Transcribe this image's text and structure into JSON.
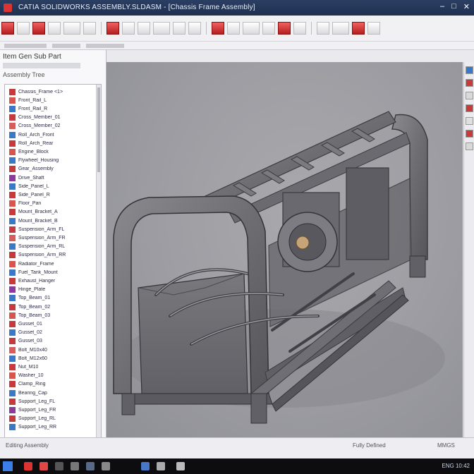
{
  "window": {
    "title": "CATIA  SOLIDWORKS  ASSEMBLY.SLDASM  -  [Chassis Frame Assembly]"
  },
  "left_panel": {
    "header": "Item  Gen  Sub  Part",
    "label3": "Assembly Tree"
  },
  "tree": {
    "items": [
      {
        "label": "Chassis_Frame <1>",
        "icon_color": "#c7393a"
      },
      {
        "label": "Front_Rail_L",
        "icon_color": "#d9544d"
      },
      {
        "label": "Front_Rail_R",
        "icon_color": "#3a78c9"
      },
      {
        "label": "Cross_Member_01",
        "icon_color": "#c7393a"
      },
      {
        "label": "Cross_Member_02",
        "icon_color": "#d95c5c"
      },
      {
        "label": "Roll_Arch_Front",
        "icon_color": "#3a78c9"
      },
      {
        "label": "Roll_Arch_Rear",
        "icon_color": "#c7393a"
      },
      {
        "label": "Engine_Block",
        "icon_color": "#d9544d"
      },
      {
        "label": "Flywheel_Housing",
        "icon_color": "#3a78c9"
      },
      {
        "label": "Gear_Assembly",
        "icon_color": "#c7393a"
      },
      {
        "label": "Drive_Shaft",
        "icon_color": "#8b3a9e"
      },
      {
        "label": "Side_Panel_L",
        "icon_color": "#3a78c9"
      },
      {
        "label": "Side_Panel_R",
        "icon_color": "#c7393a"
      },
      {
        "label": "Floor_Pan",
        "icon_color": "#d9544d"
      },
      {
        "label": "Mount_Bracket_A",
        "icon_color": "#c7393a"
      },
      {
        "label": "Mount_Bracket_B",
        "icon_color": "#3a78c9"
      },
      {
        "label": "Suspension_Arm_FL",
        "icon_color": "#c7393a"
      },
      {
        "label": "Suspension_Arm_FR",
        "icon_color": "#d95c5c"
      },
      {
        "label": "Suspension_Arm_RL",
        "icon_color": "#3a78c9"
      },
      {
        "label": "Suspension_Arm_RR",
        "icon_color": "#c7393a"
      },
      {
        "label": "Radiator_Frame",
        "icon_color": "#d9544d"
      },
      {
        "label": "Fuel_Tank_Mount",
        "icon_color": "#3a78c9"
      },
      {
        "label": "Exhaust_Hanger",
        "icon_color": "#c7393a"
      },
      {
        "label": "Hinge_Plate",
        "icon_color": "#8b3a9e"
      },
      {
        "label": "Top_Beam_01",
        "icon_color": "#3a78c9"
      },
      {
        "label": "Top_Beam_02",
        "icon_color": "#c7393a"
      },
      {
        "label": "Top_Beam_03",
        "icon_color": "#d9544d"
      },
      {
        "label": "Gusset_01",
        "icon_color": "#c7393a"
      },
      {
        "label": "Gusset_02",
        "icon_color": "#3a78c9"
      },
      {
        "label": "Gusset_03",
        "icon_color": "#c7393a"
      },
      {
        "label": "Bolt_M10x40",
        "icon_color": "#d95c5c"
      },
      {
        "label": "Bolt_M12x60",
        "icon_color": "#3a78c9"
      },
      {
        "label": "Nut_M10",
        "icon_color": "#c7393a"
      },
      {
        "label": "Washer_10",
        "icon_color": "#d9544d"
      },
      {
        "label": "Clamp_Ring",
        "icon_color": "#c7393a"
      },
      {
        "label": "Bearing_Cap",
        "icon_color": "#3a78c9"
      },
      {
        "label": "Support_Leg_FL",
        "icon_color": "#c7393a"
      },
      {
        "label": "Support_Leg_FR",
        "icon_color": "#8b3a9e"
      },
      {
        "label": "Support_Leg_RL",
        "icon_color": "#c7393a"
      },
      {
        "label": "Support_Leg_RR",
        "icon_color": "#3a78c9"
      }
    ]
  },
  "toolbar": {
    "buttons": [
      {
        "name": "new-file-button",
        "color": "#c7393a"
      },
      {
        "name": "open-button",
        "color": "#cccccc"
      },
      {
        "name": "save-button",
        "color": "#c7393a"
      },
      {
        "name": "print-button",
        "color": "#cccccc"
      },
      {
        "name": "undo-button",
        "color": "#cccccc"
      },
      {
        "name": "redo-button",
        "color": "#cccccc"
      },
      {
        "name": "rebuild-button",
        "color": "#c7393a"
      },
      {
        "name": "options-button",
        "color": "#cccccc"
      },
      {
        "name": "zoom-fit-button",
        "color": "#cccccc"
      },
      {
        "name": "zoom-area-button",
        "color": "#cccccc"
      },
      {
        "name": "rotate-button",
        "color": "#cccccc"
      },
      {
        "name": "pan-button",
        "color": "#cccccc"
      },
      {
        "name": "section-view-button",
        "color": "#c7393a"
      },
      {
        "name": "view-orientation-button",
        "color": "#cccccc"
      },
      {
        "name": "display-style-button",
        "color": "#cccccc"
      },
      {
        "name": "hide-show-button",
        "color": "#cccccc"
      },
      {
        "name": "appearance-button",
        "color": "#c7393a"
      },
      {
        "name": "scene-button",
        "color": "#cccccc"
      },
      {
        "name": "measure-button",
        "color": "#cccccc"
      },
      {
        "name": "mass-properties-button",
        "color": "#cccccc"
      },
      {
        "name": "interference-button",
        "color": "#c7393a"
      },
      {
        "name": "explode-button",
        "color": "#cccccc"
      }
    ]
  },
  "statusbar": {
    "left": "Editing Assembly",
    "middle": "Fully Defined",
    "right": "MMGS"
  },
  "taskbar": {
    "tray": "ENG  10:42"
  }
}
